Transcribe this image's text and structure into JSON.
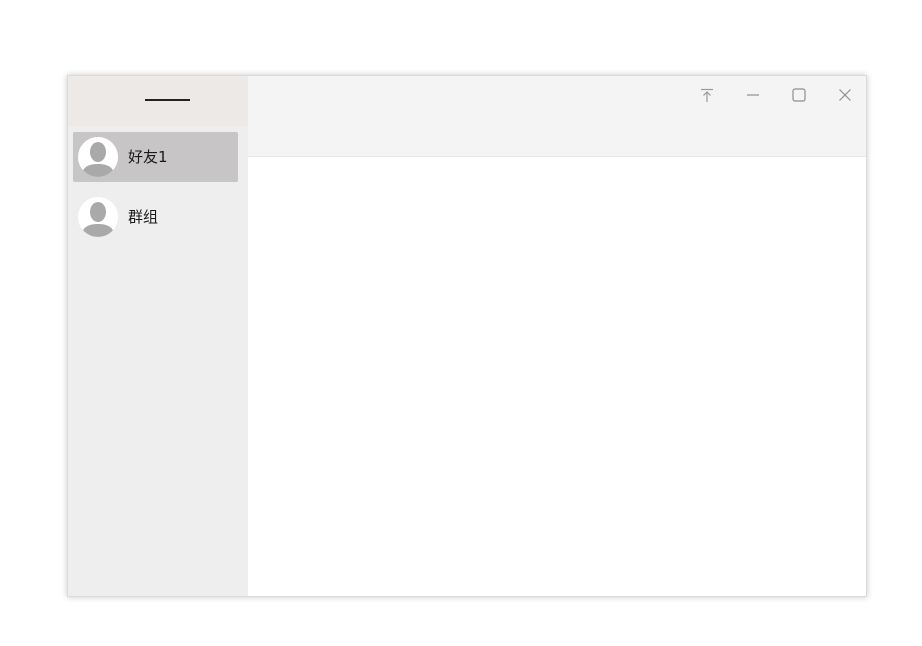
{
  "sidebar": {
    "contacts": [
      {
        "name": "好友1",
        "selected": true,
        "icon": "avatar-icon"
      },
      {
        "name": "群组",
        "selected": false,
        "icon": "avatar-icon"
      }
    ]
  },
  "titlebar": {
    "buttons": [
      "pin-top-icon",
      "minimize-icon",
      "maximize-icon",
      "close-icon"
    ]
  },
  "colors": {
    "sidebar_bg": "#eeeeee",
    "sidebar_header_bg": "#ede9e7",
    "selected_bg": "#c7c5c6",
    "titlebar_bg": "#f4f4f4",
    "icon_gray": "#9a9a9a"
  }
}
